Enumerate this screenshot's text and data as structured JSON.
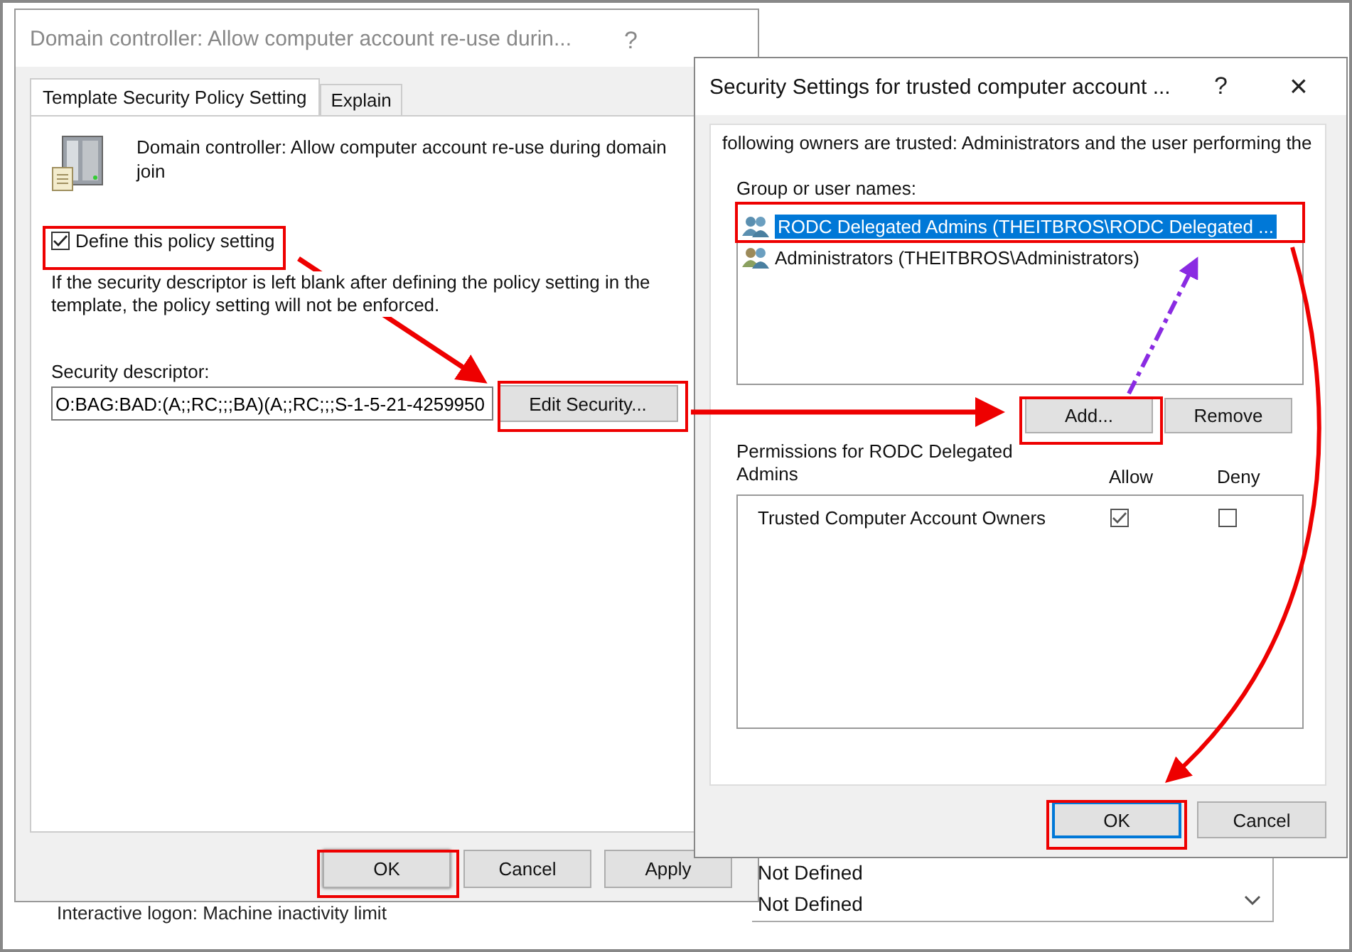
{
  "policy_dialog": {
    "title": "Domain controller: Allow computer account re-use durin...",
    "help": "?",
    "tabs": [
      {
        "label": "Template Security Policy Setting",
        "selected": true
      },
      {
        "label": "Explain",
        "selected": false
      }
    ],
    "policy_name": "Domain controller: Allow computer account re-use during domain join",
    "define_checkbox": {
      "label": "Define this policy setting",
      "checked": true
    },
    "note": "If the security descriptor is left blank after defining the policy setting in the template, the policy setting will not be enforced.",
    "descriptor_label": "Security descriptor:",
    "descriptor_value": "O:BAG:BAD:(A;;RC;;;BA)(A;;RC;;;S-1-5-21-4259950",
    "edit_button": "Edit Security...",
    "buttons": [
      {
        "label": "OK",
        "highlighted": true
      },
      {
        "label": "Cancel",
        "highlighted": false
      },
      {
        "label": "Apply",
        "highlighted": false
      }
    ]
  },
  "security_dialog": {
    "title": "Security Settings for trusted computer account ...",
    "help": "?",
    "close": "×",
    "description": "following owners are trusted: Administrators and the user performing the",
    "group_label": "Group or user names:",
    "principals": [
      {
        "name": "RODC Delegated Admins (THEITBROS\\RODC Delegated ...",
        "selected": true
      },
      {
        "name": "Administrators (THEITBROS\\Administrators)",
        "selected": false
      }
    ],
    "add_button": "Add...",
    "remove_button": "Remove",
    "permissions_label": "Permissions for RODC Delegated Admins",
    "allow_header": "Allow",
    "deny_header": "Deny",
    "permissions": [
      {
        "name": "Trusted Computer Account Owners",
        "allow": true,
        "deny": false
      }
    ],
    "buttons": [
      {
        "label": "OK",
        "default": true
      },
      {
        "label": "Cancel",
        "default": false
      }
    ]
  },
  "background_list": {
    "policy": "Interactive logon: Machine inactivity limit",
    "values": [
      "Not Defined",
      "Not Defined"
    ]
  }
}
